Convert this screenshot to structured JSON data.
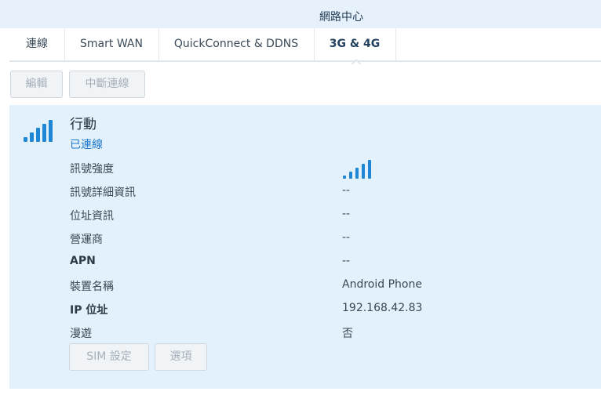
{
  "window": {
    "title": "網路中心"
  },
  "tabs": [
    {
      "label": "連線"
    },
    {
      "label": "Smart WAN"
    },
    {
      "label": "QuickConnect & DDNS"
    },
    {
      "label": "3G & 4G",
      "active": true
    }
  ],
  "toolbar": {
    "edit_label": "編輯",
    "disconnect_label": "中斷連線"
  },
  "connection": {
    "icon": "signal-bars-icon",
    "name": "行動",
    "status": "已連線",
    "status_color": "#1e78c8",
    "signal_strength_level": 4
  },
  "details": [
    {
      "label": "訊號強度",
      "value": ""
    },
    {
      "label": "訊號詳細資訊",
      "value": "--"
    },
    {
      "label": "位址資訊",
      "value": "--"
    },
    {
      "label": "營運商",
      "value": "--"
    },
    {
      "label": "APN",
      "value": "--"
    },
    {
      "label": "裝置名稱",
      "value": "Android Phone"
    },
    {
      "label": "IP 位址",
      "value": "192.168.42.83"
    },
    {
      "label": "漫遊",
      "value": "否"
    }
  ],
  "actions": {
    "sim_settings_label": "SIM 設定",
    "options_label": "選項"
  },
  "colors": {
    "accent": "#1f86d6",
    "panel_bg": "#e3f1fc",
    "titlebar_bg": "#e6f1fb"
  }
}
